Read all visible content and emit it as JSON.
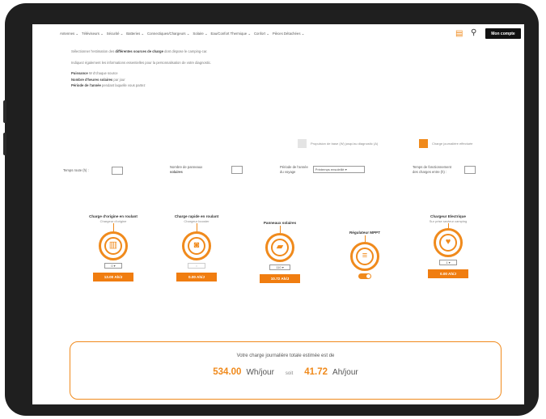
{
  "nav": {
    "items": [
      "Antennes ⌄",
      "Téléviseurs ⌄",
      "Sécurité ⌄",
      "Batteries ⌄",
      "Connectiques/Chargeurs ⌄",
      "Solaire ⌄",
      "Eau/Confort Thermique ⌄",
      "Confort ⌄",
      "Pièces Détachées ⌄"
    ],
    "account_label": "Mon compte"
  },
  "intro": {
    "line1_pre": "Sélectionner l'estimation des ",
    "line1_bold": "différentes sources de charge",
    "line1_post": " dont dispose le camping-car.",
    "line2": "Indiquez également les informations essentielles pour la personnalisation de votre diagnostic.",
    "items": [
      {
        "label": "Puissance",
        "text": " W d'chaque source"
      },
      {
        "label": "Nombre d'heures solaires",
        "text": " par jour"
      },
      {
        "label": "Période de l'année",
        "text": " pendant laquelle vous partez"
      }
    ]
  },
  "legend": {
    "off_label": "Propulsion de base (W) jusqu'au diagnostic (A)",
    "on_label": "Charge journalière effectuée"
  },
  "params": {
    "p1_label": "Temps route (h) :",
    "p2_label_a": "Nombre de panneaux",
    "p2_label_b": "solaires",
    "p3_label_a": "Période de l'année",
    "p3_label_b": "du voyage",
    "p3_value": "Printemps ensoleillé ▾",
    "p4_label_a": "Temps de fonctionnement",
    "p4_label_b": "des charges entre (h) :"
  },
  "sources": [
    {
      "title": "Charge d'origine en roulant",
      "sub": "Chargeur d'origine",
      "icon": "battery-charge-icon",
      "glyph": "▥",
      "control": "0 ▾",
      "value": "13.00 Ah/J"
    },
    {
      "title": "Charge rapide en roulant",
      "sub": "Chargeur booster",
      "icon": "booster-charger-icon",
      "glyph": "◙",
      "control": "○",
      "value": "0.00 Ah/J"
    },
    {
      "title": "Panneaux solaires",
      "sub": "",
      "icon": "solar-panel-icon",
      "glyph": "▰",
      "control": "110 ▾",
      "value": "10.72 Ah/J"
    },
    {
      "title": "Régulateur MPPT",
      "sub": "",
      "icon": "mppt-regulator-icon",
      "glyph": "≡",
      "control": "",
      "value": ""
    },
    {
      "title": "Chargeur Electrique",
      "sub": "Sur prise secteur camping",
      "icon": "electric-charger-icon",
      "glyph": "♥",
      "control": "1 ▾",
      "value": "0.00 Ah/J"
    }
  ],
  "result": {
    "question": "Votre charge journalière totale estimée est de",
    "wh_value": "534.00",
    "wh_unit": "Wh/jour",
    "soit": "soit",
    "ah_value": "41.72",
    "ah_unit": "Ah/jour"
  },
  "colors": {
    "accent": "#f08a1c",
    "account_bg": "#111111"
  }
}
